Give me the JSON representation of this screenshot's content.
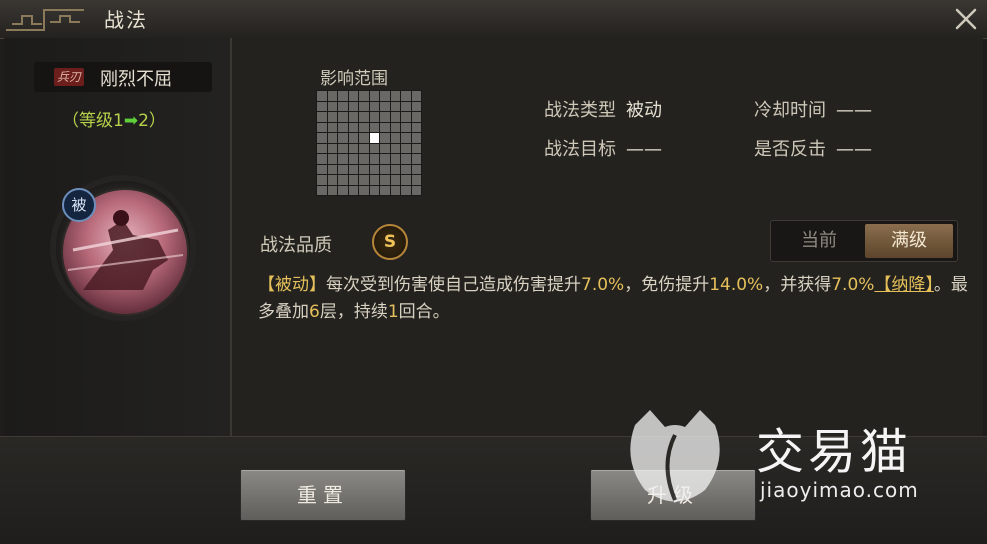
{
  "window": {
    "title": "战法"
  },
  "skill": {
    "type_badge": "兵刃",
    "name": "刚烈不屈",
    "level_prefix": "（等级1",
    "level_arrow": "➡",
    "level_suffix": "2）",
    "passive_badge": "被"
  },
  "range": {
    "label": "影响范围",
    "cols": 10,
    "rows": 10,
    "active_cell": [
      4,
      5
    ]
  },
  "attributes": [
    {
      "key": "战法类型",
      "value": "被动"
    },
    {
      "key": "冷却时间",
      "value": "——"
    },
    {
      "key": "战法目标",
      "value": "——"
    },
    {
      "key": "是否反击",
      "value": "——"
    }
  ],
  "quality": {
    "label": "战法品质",
    "grade": "S"
  },
  "view_toggle": {
    "current": "当前",
    "max": "满级",
    "selected": "max"
  },
  "description": {
    "p1": "【被动】",
    "p2": "每次受到伤害使自己造成伤害提升",
    "v1": "7.0%",
    "p3": "，免伤提升",
    "v2": "14.0%",
    "p4": "，并获得",
    "v3": "7.0%",
    "kw": "【纳降】",
    "p5": "。最多叠加",
    "v4": "6",
    "p6": "层，持续",
    "v5": "1",
    "p7": "回合。"
  },
  "buttons": {
    "reset": "重置",
    "upgrade": "升级"
  },
  "watermark": {
    "brand": "交易猫",
    "url": "jiaoyimao.com"
  },
  "colors": {
    "accent_green": "#b6d24a",
    "gold": "#e5c05a",
    "quality": "#f1c45a"
  }
}
